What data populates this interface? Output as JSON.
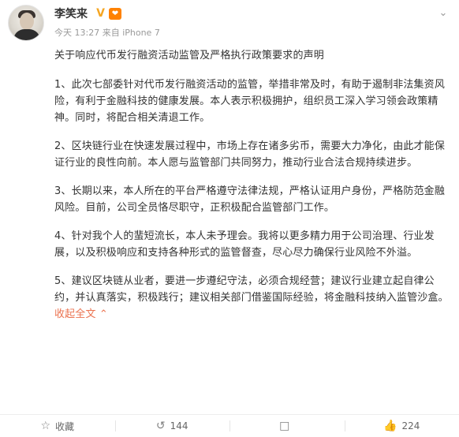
{
  "post": {
    "author": "李笑来",
    "meta": "今天 13:27 来自 iPhone 7",
    "title": "关于响应代币发行融资活动监管及严格执行政策要求的声明",
    "paragraphs": [
      "1、此次七部委针对代币发行融资活动的监管，举措非常及时，有助于遏制非法集资风险，有利于金融科技的健康发展。本人表示积极拥护，组织员工深入学习领会政策精神。同时，将配合相关清退工作。",
      "2、区块链行业在快速发展过程中，市场上存在诸多劣币，需要大力净化，由此才能保证行业的良性向前。本人愿与监管部门共同努力，推动行业合法合规持续进步。",
      "3、长期以来，本人所在的平台严格遵守法律法规，严格认证用户身份，严格防范金融风险。目前，公司全员恪尽职守，正积极配合监管部门工作。",
      "4、针对我个人的蜚短流长，本人未予理会。我将以更多精力用于公司治理、行业发展，以及积极响应和支持各种形式的监管督查，尽心尽力确保行业风险不外溢。",
      "5、建议区块链从业者，要进一步遵纪守法，必须合规经营；建议行业建立起自律公约，并认真落实，积极践行；建议相关部门借鉴国际经验，将金融科技纳入监管沙盒。"
    ],
    "collapse_label": "收起全文",
    "collapse_icon": "chevron-up-icon"
  },
  "badges": {
    "verified": "V",
    "vip": "❤"
  },
  "actions": {
    "favorite_label": "收藏",
    "repost_count": "144",
    "comment_count": "",
    "like_count": "224"
  },
  "colors": {
    "link": "#eb7350",
    "verified": "#f5a623",
    "vip": "#ff8200"
  }
}
